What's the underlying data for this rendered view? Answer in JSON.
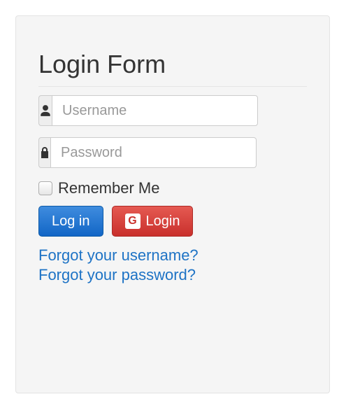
{
  "form": {
    "title": "Login Form",
    "username": {
      "value": "",
      "placeholder": "Username"
    },
    "password": {
      "value": "",
      "placeholder": "Password"
    },
    "remember_label": "Remember Me",
    "login_button": "Log in",
    "google_button": "Login",
    "google_badge": "G",
    "links": {
      "forgot_username": "Forgot your username?",
      "forgot_password": "Forgot your password?"
    }
  },
  "colors": {
    "panel_bg": "#f5f5f5",
    "primary": "#1266c6",
    "danger": "#c9302c",
    "link": "#1e73c5"
  }
}
